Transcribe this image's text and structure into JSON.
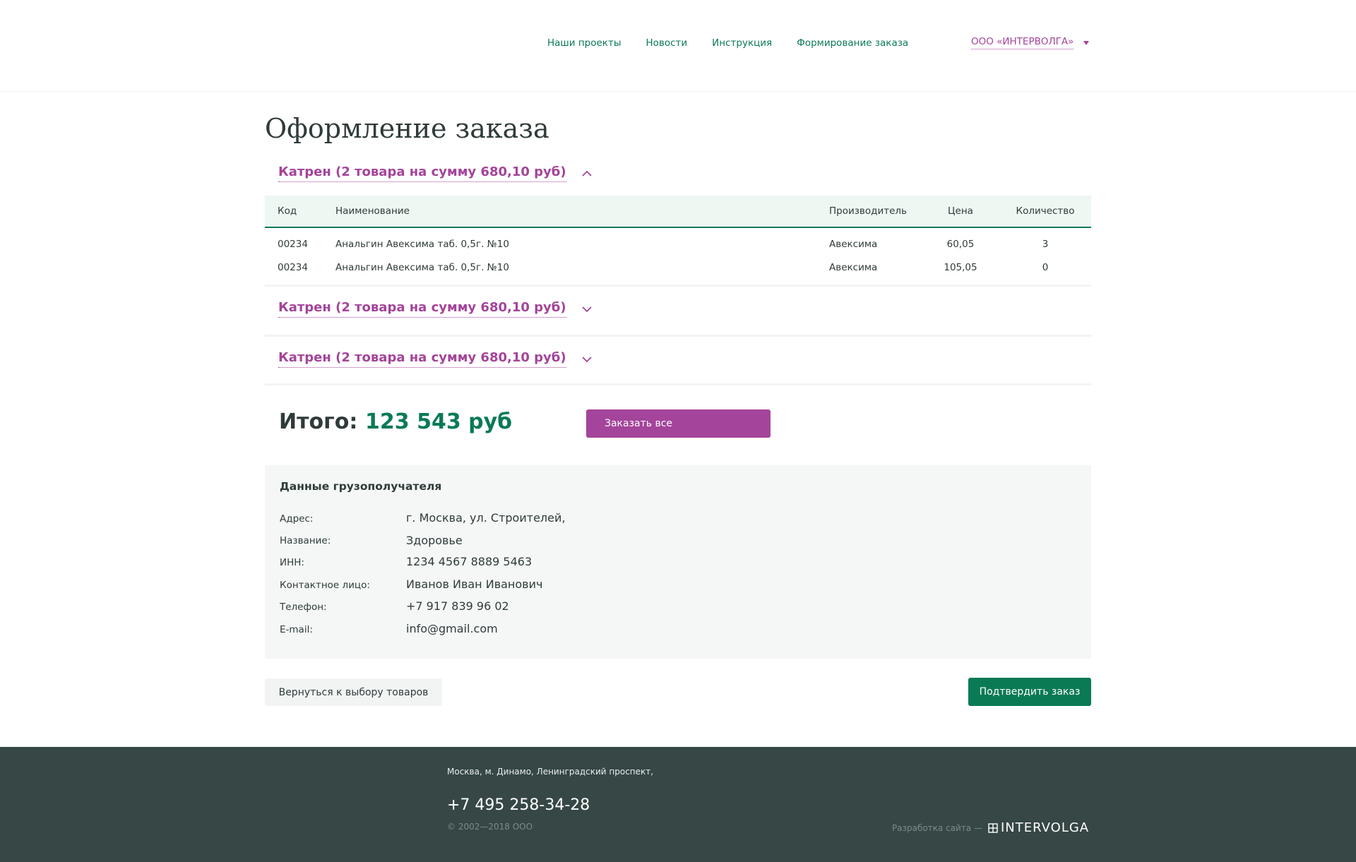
{
  "nav": {
    "items": [
      "Наши проекты",
      "Новости",
      "Инструкция",
      "Формирование заказа"
    ],
    "company": "ООО «ИНТЕРВОЛГА»"
  },
  "page_title": "Оформление заказа",
  "groups": [
    {
      "label": "Катрен (2 товара  на сумму 680,10 руб)",
      "expanded": true
    },
    {
      "label": "Катрен (2 товара  на сумму 680,10 руб)",
      "expanded": false
    },
    {
      "label": "Катрен (2 товара  на сумму 680,10 руб)",
      "expanded": false
    }
  ],
  "table": {
    "headers": {
      "code": "Код",
      "name": "Наименование",
      "manufacturer": "Производитель",
      "price": "Цена",
      "qty": "Количество"
    },
    "rows": [
      {
        "code": "00234",
        "name": "Анальгин Авексима таб. 0,5г. №10",
        "manufacturer": "Авексима",
        "price": "60,05",
        "qty": "3"
      },
      {
        "code": "00234",
        "name": "Анальгин Авексима таб. 0,5г. №10",
        "manufacturer": "Авексима",
        "price": "105,05",
        "qty": "0"
      }
    ]
  },
  "total": {
    "label": "Итого:",
    "value": "123 543 руб"
  },
  "order_all_label": "Заказать все",
  "consignee": {
    "title": "Данные грузополучателя",
    "fields": [
      {
        "label": "Адрес:",
        "value": "г. Москва, ул. Строителей,"
      },
      {
        "label": "Название:",
        "value": "Здоровье"
      },
      {
        "label": "ИНН:",
        "value": "1234 4567 8889 5463"
      },
      {
        "label": "Контактное лицо:",
        "value": "Иванов Иван Иванович"
      },
      {
        "label": "Телефон:",
        "value": "+7 917 839 96 02"
      },
      {
        "label": "E-mail:",
        "value": "info@gmail.com"
      }
    ]
  },
  "back_label": "Вернуться к выбору товаров",
  "confirm_label": "Подтвердить заказ",
  "footer": {
    "address": "Москва, м. Динамо, Ленинградский проспект,",
    "phone": "+7 495 258-34-28",
    "copyright": "© 2002—2018 ООО",
    "dev_text": "Разработка сайта —",
    "brand": "INTERVOLGA"
  },
  "colors": {
    "accent": "#a4449a",
    "brand_green": "#0a7a55",
    "footer_bg": "#364746",
    "table_header_bg": "#eef7f2"
  },
  "icons": {
    "collapse": "chevron-up-icon",
    "expand": "chevron-down-icon",
    "company_menu": "caret-down-icon",
    "brand": "intervolga-logo-icon"
  }
}
